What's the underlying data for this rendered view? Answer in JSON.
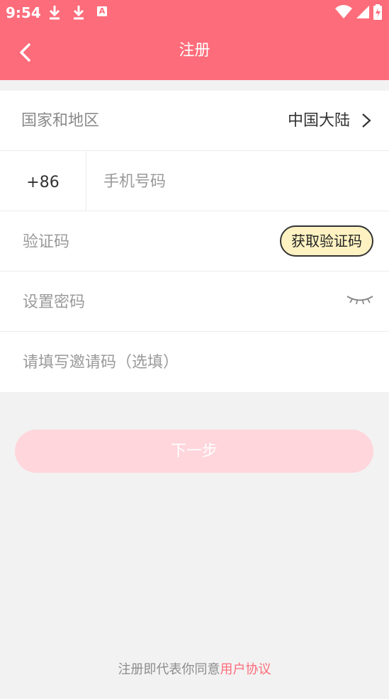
{
  "status_bar": {
    "time": "9:54",
    "icons": [
      "download-icon",
      "download-icon",
      "a-icon",
      "wifi-icon",
      "signal-icon",
      "battery-icon"
    ],
    "a_icon_text": "A"
  },
  "header": {
    "title": "注册",
    "back_icon": "back-arrow-icon"
  },
  "form": {
    "region": {
      "label": "国家和地区",
      "value": "中国大陆"
    },
    "phone": {
      "country_code": "+86",
      "placeholder": "手机号码",
      "value": ""
    },
    "verify": {
      "placeholder": "验证码",
      "value": "",
      "button_label": "获取验证码"
    },
    "password": {
      "placeholder": "设置密码",
      "value": "",
      "toggle_icon": "eye-closed-icon"
    },
    "invite": {
      "placeholder": "请填写邀请码（选填）",
      "value": ""
    }
  },
  "actions": {
    "next_label": "下一步"
  },
  "agreement": {
    "prefix": "注册即代表你同意",
    "link": "用户协议"
  },
  "colors": {
    "primary": "#fd6c7a",
    "button_disabled": "#ffd6dc",
    "code_button_bg": "#fff2c2",
    "background": "#f2f2f2"
  }
}
